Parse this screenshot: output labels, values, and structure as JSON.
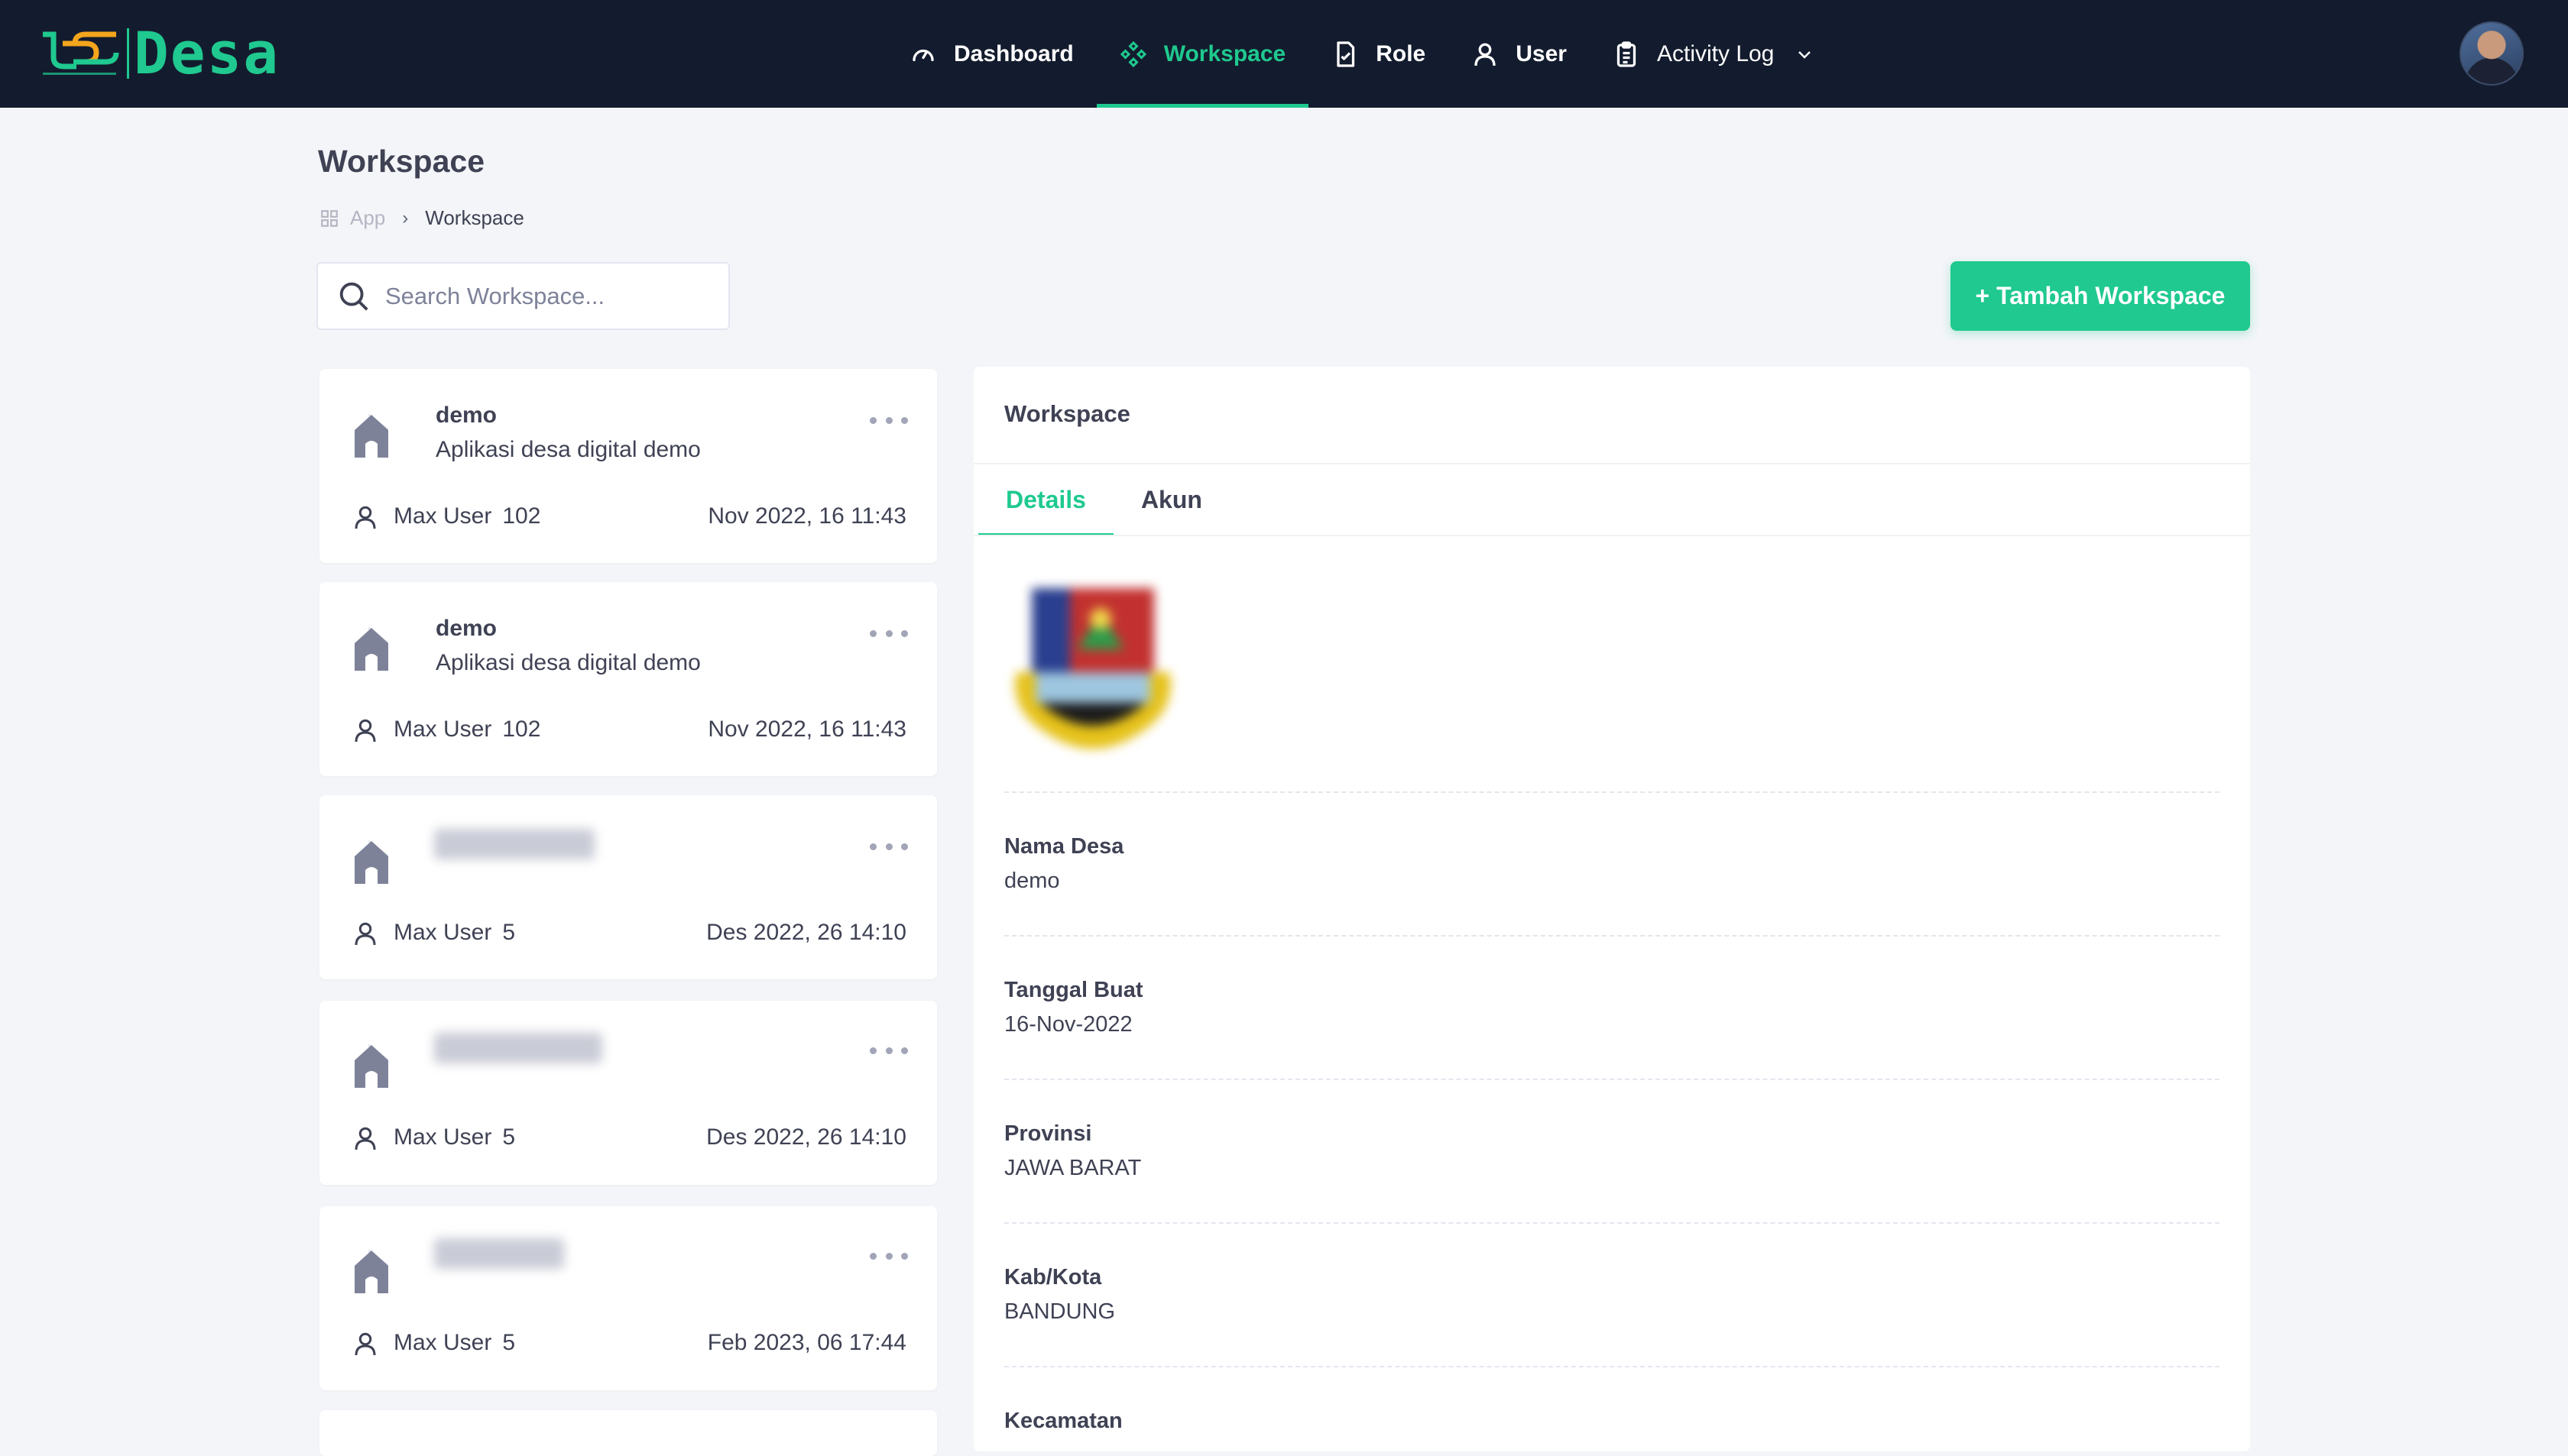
{
  "nav": {
    "brand": "Desa",
    "items": [
      {
        "label": "Dashboard",
        "icon": "gauge-icon"
      },
      {
        "label": "Workspace",
        "icon": "diamond-grid-icon",
        "active": true
      },
      {
        "label": "Role",
        "icon": "document-check-icon"
      },
      {
        "label": "User",
        "icon": "user-icon"
      },
      {
        "label": "Activity Log",
        "icon": "clipboard-icon",
        "dropdown": true
      }
    ]
  },
  "page": {
    "title": "Workspace",
    "breadcrumb": [
      "App",
      "Workspace"
    ]
  },
  "search": {
    "placeholder": "Search Workspace..."
  },
  "add_button": {
    "label": "+ Tambah Workspace"
  },
  "accent_color": "#1fc98f",
  "workspaces": [
    {
      "name": "demo",
      "description": "Aplikasi desa digital demo",
      "max_user_label": "Max User",
      "max_user": "102",
      "date": "Nov 2022, 16 11:43"
    },
    {
      "name": "demo",
      "description": "Aplikasi desa digital demo",
      "max_user_label": "Max User",
      "max_user": "102",
      "date": "Nov 2022, 16 11:43"
    },
    {
      "name": "",
      "description": "",
      "max_user_label": "Max User",
      "max_user": "5",
      "date": "Des 2022, 26 14:10"
    },
    {
      "name": "",
      "description": "",
      "max_user_label": "Max User",
      "max_user": "5",
      "date": "Des 2022, 26 14:10"
    },
    {
      "name": "",
      "description": "",
      "max_user_label": "Max User",
      "max_user": "5",
      "date": "Feb 2023, 06 17:44"
    }
  ],
  "detail": {
    "title": "Workspace",
    "tabs": [
      {
        "label": "Details",
        "active": true
      },
      {
        "label": "Akun"
      }
    ],
    "fields": [
      {
        "label": "Nama Desa",
        "value": "demo"
      },
      {
        "label": "Tanggal Buat",
        "value": "16-Nov-2022"
      },
      {
        "label": "Provinsi",
        "value": "JAWA BARAT"
      },
      {
        "label": "Kab/Kota",
        "value": "BANDUNG"
      },
      {
        "label": "Kecamatan",
        "value": ""
      }
    ]
  }
}
